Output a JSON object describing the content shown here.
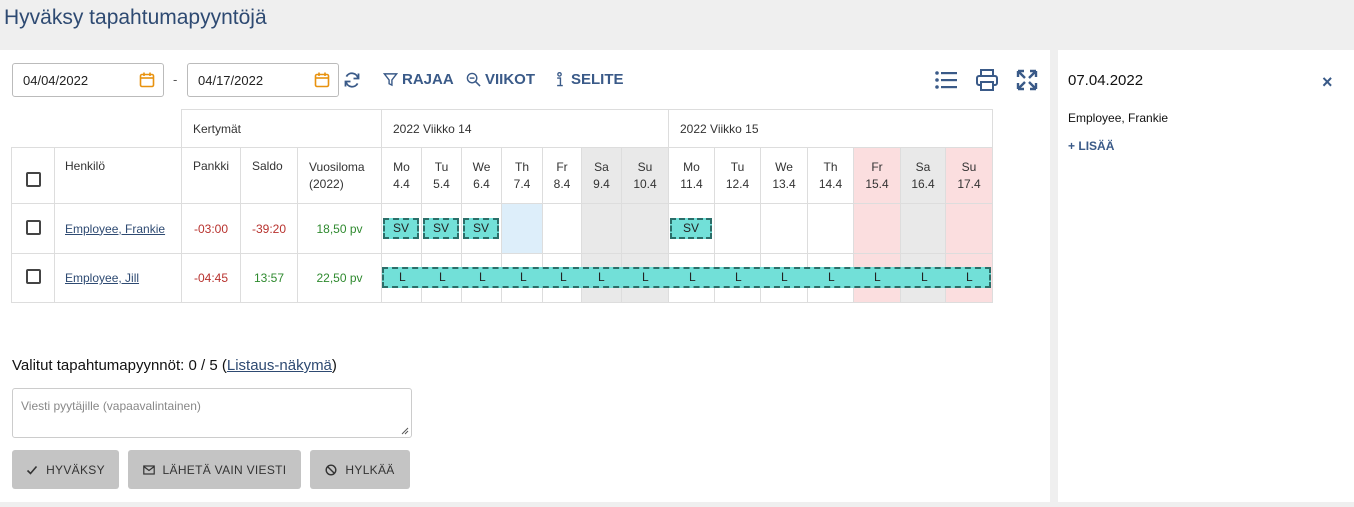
{
  "page": {
    "title": "Hyväksy tapahtumapyyntöjä"
  },
  "filters": {
    "start_date": "04/04/2022",
    "end_date": "04/17/2022",
    "separator": "-"
  },
  "toolbar": {
    "filter_label": "RAJAA",
    "weeks_label": "VIIKOT",
    "legend_label": "SELITE"
  },
  "table": {
    "group_totals": "Kertymät",
    "week1": "2022 Viikko 14",
    "week2": "2022 Viikko 15",
    "col_person": "Henkilö",
    "col_bank": "Pankki",
    "col_saldo": "Saldo",
    "col_vacation": "Vuosiloma",
    "col_vacation_year": "(2022)",
    "days": [
      {
        "dow": "Mo",
        "date": "4.4"
      },
      {
        "dow": "Tu",
        "date": "5.4"
      },
      {
        "dow": "We",
        "date": "6.4"
      },
      {
        "dow": "Th",
        "date": "7.4"
      },
      {
        "dow": "Fr",
        "date": "8.4"
      },
      {
        "dow": "Sa",
        "date": "9.4"
      },
      {
        "dow": "Su",
        "date": "10.4"
      },
      {
        "dow": "Mo",
        "date": "11.4"
      },
      {
        "dow": "Tu",
        "date": "12.4"
      },
      {
        "dow": "We",
        "date": "13.4"
      },
      {
        "dow": "Th",
        "date": "14.4"
      },
      {
        "dow": "Fr",
        "date": "15.4"
      },
      {
        "dow": "Sa",
        "date": "16.4"
      },
      {
        "dow": "Su",
        "date": "17.4"
      }
    ],
    "rows": [
      {
        "name": "Employee, Frankie",
        "bank": "-03:00",
        "saldo": "-39:20",
        "vacation": "18,50 pv",
        "events": [
          "SV",
          "SV",
          "SV",
          "",
          "",
          "",
          "",
          "SV",
          "",
          "",
          "",
          "",
          "",
          ""
        ]
      },
      {
        "name": "Employee, Jill",
        "bank": "-04:45",
        "saldo": "13:57",
        "vacation": "22,50 pv",
        "events": [
          "L",
          "L",
          "L",
          "L",
          "L",
          "L",
          "L",
          "L",
          "L",
          "L",
          "L",
          "L",
          "L",
          "L"
        ]
      }
    ]
  },
  "selection": {
    "label": "Valitut tapahtumapyynnöt: 0 / 5 (",
    "link": "Listaus-näkymä",
    "close": ")"
  },
  "message": {
    "placeholder": "Viesti pyytäjille (vapaavalintainen)"
  },
  "buttons": {
    "approve": "HYVÄKSY",
    "send_message": "LÄHETÄ VAIN VIESTI",
    "reject": "HYLKÄÄ"
  },
  "sidepanel": {
    "date": "07.04.2022",
    "employee": "Employee, Frankie",
    "add_label": "LISÄÄ",
    "add_prefix": "+",
    "close": "×"
  },
  "colors": {
    "accent": "#3a5a88",
    "event_fill": "#72e0d8",
    "holiday": "#fbdedf",
    "weekend": "#e9e9e9",
    "selected_day": "#ddeefa"
  }
}
